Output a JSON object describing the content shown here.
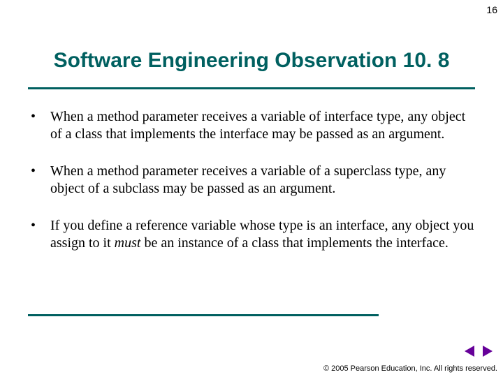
{
  "page_number": "16",
  "title": "Software Engineering Observation 10. 8",
  "bullets": [
    {
      "prefix": "When a method parameter receives a variable of interface type, any object of a class that implements the interface may be passed as an argument."
    },
    {
      "prefix": "When a method parameter receives a variable of a superclass type, any object of a subclass  may be passed as an argument."
    },
    {
      "prefix": "If you define a reference variable whose type is an interface, any object you assign to it ",
      "italic": "must",
      "suffix": " be an instance of a class that implements the interface."
    }
  ],
  "copyright": "© 2005 Pearson Education, Inc.  All rights reserved.",
  "colors": {
    "accent": "#006060",
    "nav": "#660099"
  }
}
